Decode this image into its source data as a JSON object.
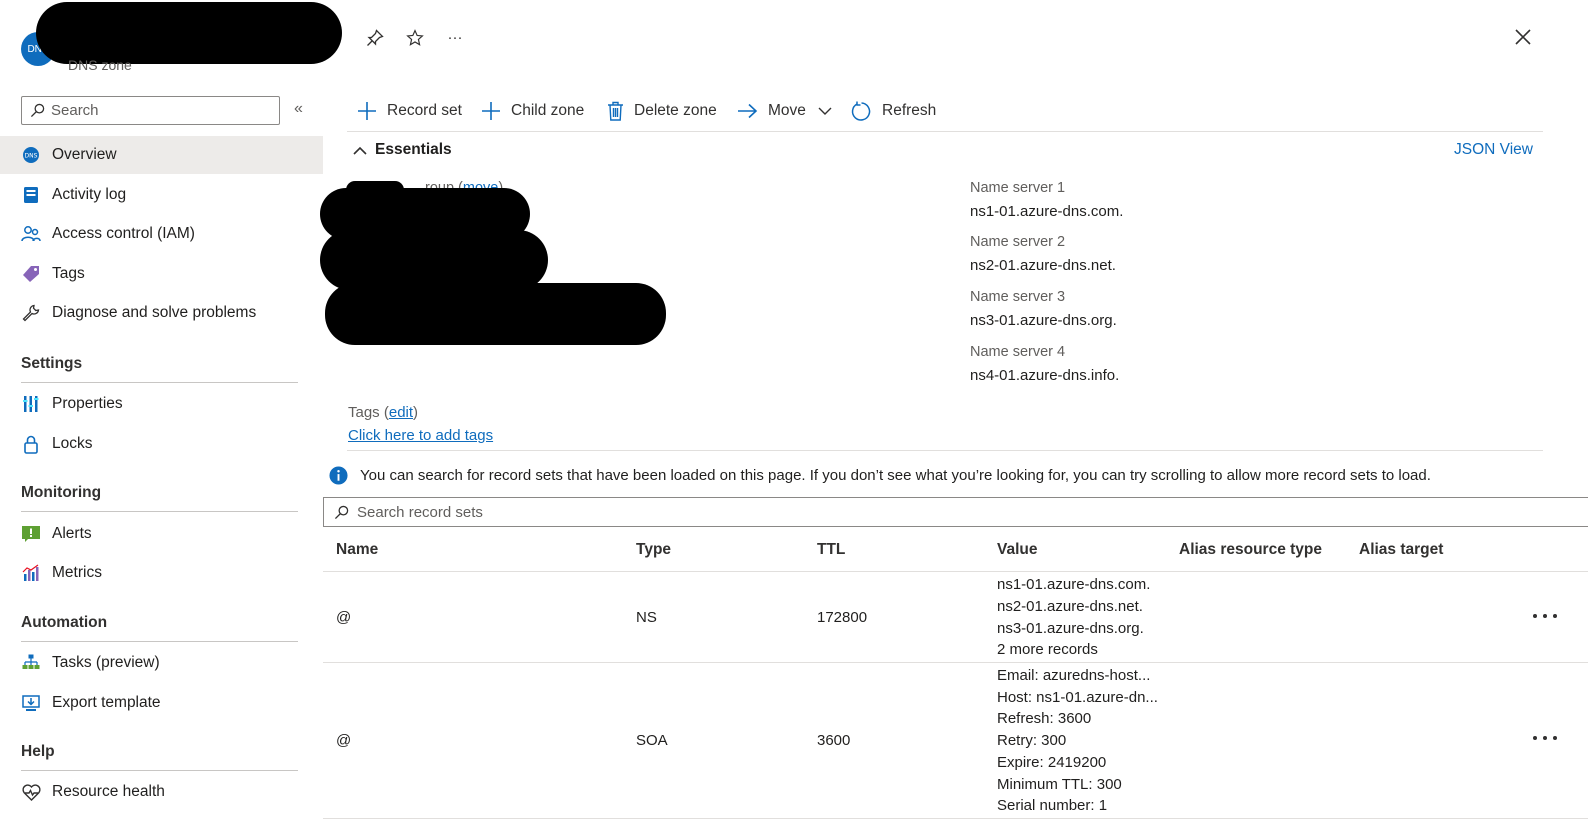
{
  "header": {
    "avatar_text": "DNS",
    "subtitle": "DNS zone",
    "more_label": "···"
  },
  "sidebar": {
    "search_placeholder": "Search",
    "collapse_label": "«",
    "top_items": [
      {
        "label": "Overview",
        "icon": "dns-icon"
      },
      {
        "label": "Activity log",
        "icon": "activity-log-icon"
      },
      {
        "label": "Access control (IAM)",
        "icon": "people-icon"
      },
      {
        "label": "Tags",
        "icon": "tag-icon"
      },
      {
        "label": "Diagnose and solve problems",
        "icon": "wrench-icon"
      }
    ],
    "sections": [
      {
        "title": "Settings",
        "items": [
          {
            "label": "Properties",
            "icon": "properties-icon"
          },
          {
            "label": "Locks",
            "icon": "lock-icon"
          }
        ]
      },
      {
        "title": "Monitoring",
        "items": [
          {
            "label": "Alerts",
            "icon": "alert-icon"
          },
          {
            "label": "Metrics",
            "icon": "metrics-icon"
          }
        ]
      },
      {
        "title": "Automation",
        "items": [
          {
            "label": "Tasks (preview)",
            "icon": "tasks-icon"
          },
          {
            "label": "Export template",
            "icon": "export-icon"
          }
        ]
      },
      {
        "title": "Help",
        "items": [
          {
            "label": "Resource health",
            "icon": "heart-icon"
          }
        ]
      }
    ]
  },
  "toolbar": {
    "record_set": "Record set",
    "child_zone": "Child zone",
    "delete_zone": "Delete zone",
    "move": "Move",
    "refresh": "Refresh"
  },
  "essentials": {
    "title": "Essentials",
    "json_view": "JSON View",
    "resource_group_suffix": "roup",
    "move_link": "move",
    "name_servers": [
      {
        "label": "Name server 1",
        "value": "ns1-01.azure-dns.com."
      },
      {
        "label": "Name server 2",
        "value": "ns2-01.azure-dns.net."
      },
      {
        "label": "Name server 3",
        "value": "ns3-01.azure-dns.org."
      },
      {
        "label": "Name server 4",
        "value": "ns4-01.azure-dns.info."
      }
    ],
    "tags_label": "Tags",
    "tags_edit": "edit",
    "tags_add_link": "Click here to add tags"
  },
  "info_message": "You can search for record sets that have been loaded on this page. If you don’t see what you’re looking for, you can try scrolling to allow more record sets to load.",
  "record_search_placeholder": "Search record sets",
  "table": {
    "columns": [
      "Name",
      "Type",
      "TTL",
      "Value",
      "Alias resource type",
      "Alias target"
    ],
    "rows": [
      {
        "name": "@",
        "type": "NS",
        "ttl": "172800",
        "value": [
          "ns1-01.azure-dns.com.",
          "ns2-01.azure-dns.net.",
          "ns3-01.azure-dns.org.",
          "2 more records"
        ]
      },
      {
        "name": "@",
        "type": "SOA",
        "ttl": "3600",
        "value": [
          "Email: azuredns-host...",
          "Host: ns1-01.azure-dn...",
          "Refresh: 3600",
          "Retry: 300",
          "Expire: 2419200",
          "Minimum TTL: 300",
          "Serial number: 1"
        ]
      }
    ]
  },
  "colors": {
    "accent": "#0f6cbd",
    "active_bg": "#edebe9"
  }
}
